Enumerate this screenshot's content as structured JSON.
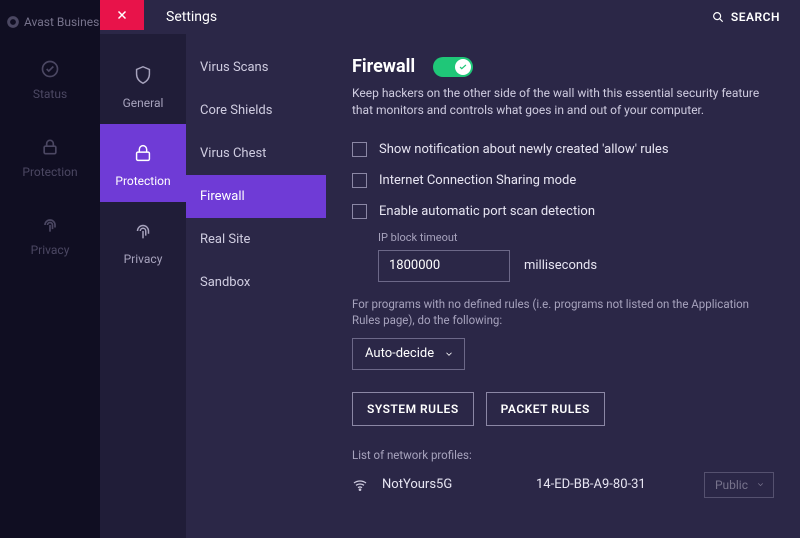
{
  "brand": "Avast Busines",
  "global_nav": [
    {
      "id": "status",
      "label": "Status"
    },
    {
      "id": "protection",
      "label": "Protection"
    },
    {
      "id": "privacy",
      "label": "Privacy"
    }
  ],
  "topbar": {
    "title": "Settings",
    "search_label": "SEARCH"
  },
  "categories": [
    {
      "id": "general",
      "label": "General",
      "active": false
    },
    {
      "id": "protection",
      "label": "Protection",
      "active": true
    },
    {
      "id": "privacy",
      "label": "Privacy",
      "active": false
    }
  ],
  "subnav": [
    {
      "id": "virus-scans",
      "label": "Virus Scans",
      "active": false
    },
    {
      "id": "core-shields",
      "label": "Core Shields",
      "active": false
    },
    {
      "id": "virus-chest",
      "label": "Virus Chest",
      "active": false
    },
    {
      "id": "firewall",
      "label": "Firewall",
      "active": true
    },
    {
      "id": "real-site",
      "label": "Real Site",
      "active": false
    },
    {
      "id": "sandbox",
      "label": "Sandbox",
      "active": false
    }
  ],
  "content": {
    "heading": "Firewall",
    "enabled": true,
    "description": "Keep hackers on the other side of the wall with this essential security feature that monitors and controls what goes in and out of your computer.",
    "checks": {
      "allow_rules_notify": {
        "label": "Show notification about newly created 'allow' rules",
        "checked": false
      },
      "ics_mode": {
        "label": "Internet Connection Sharing mode",
        "checked": false
      },
      "port_scan": {
        "label": "Enable automatic port scan detection",
        "checked": false
      }
    },
    "ip_block": {
      "label": "IP block timeout",
      "value": "1800000",
      "unit": "milliseconds"
    },
    "undefined_rules_text": "For programs with no defined rules (i.e. programs not listed on the Application Rules page), do the following:",
    "undefined_rules_select": "Auto-decide",
    "buttons": {
      "system_rules": "SYSTEM RULES",
      "packet_rules": "PACKET RULES"
    },
    "profiles_label": "List of network profiles:",
    "profiles": [
      {
        "name": "NotYours5G",
        "mac": "14-ED-BB-A9-80-31",
        "mode": "Public"
      }
    ]
  }
}
